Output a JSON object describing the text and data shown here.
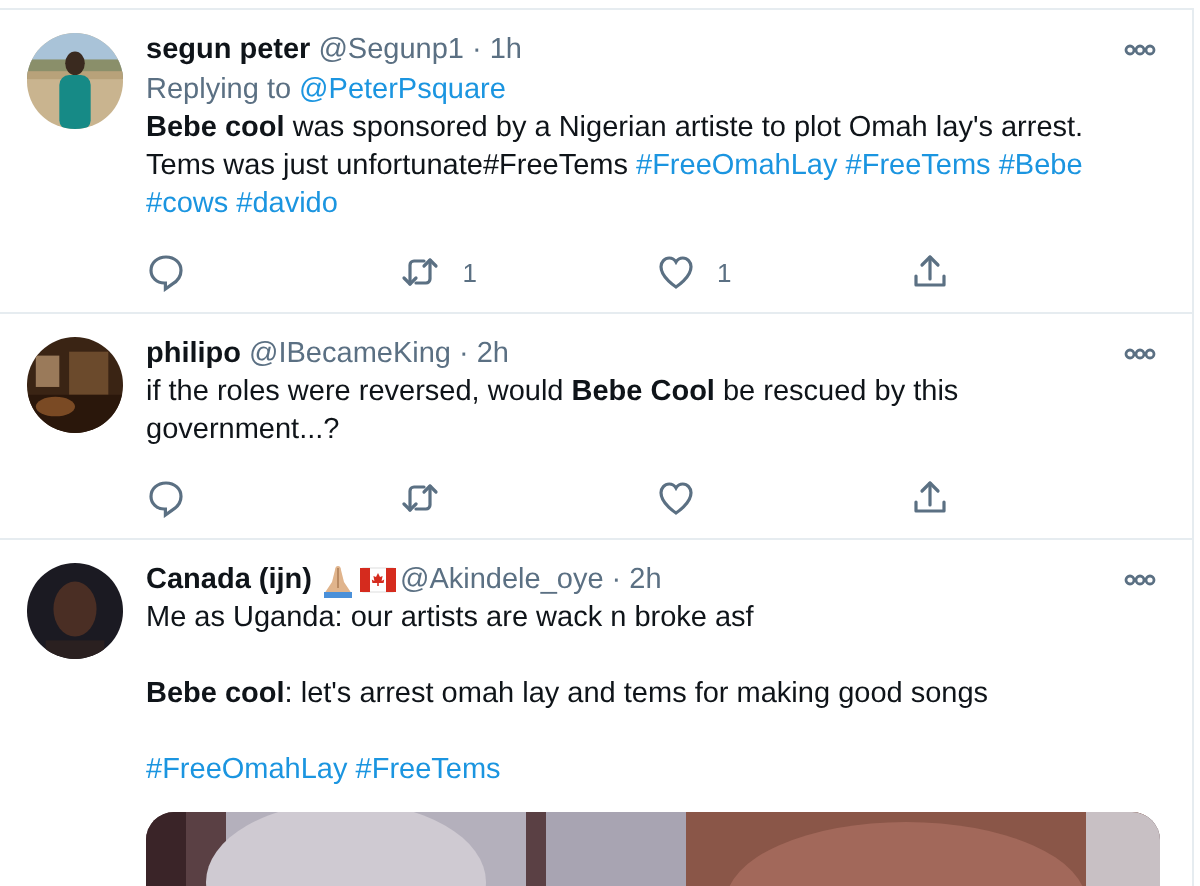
{
  "tweets": [
    {
      "name": "segun peter",
      "handle": "@Segunp1",
      "separator": "·",
      "time": "1h",
      "replying": {
        "label": "Replying to",
        "handle": "@PeterPsquare"
      },
      "paragraphs": [
        [
          {
            "kind": "text",
            "text": "**Bebe cool** was sponsored by a Nigerian artiste to plot Omah lay's arrest. Tems was just unfortunate#FreeTems "
          },
          {
            "kind": "hashtag",
            "text": "#FreeOmahLay"
          },
          {
            "kind": "hashtag",
            "text": "#FreeTems"
          },
          {
            "kind": "hashtag",
            "text": "#Bebe"
          },
          {
            "kind": "hashtag",
            "text": "#cows"
          },
          {
            "kind": "hashtag",
            "text": "#davido"
          }
        ]
      ],
      "actions": [
        {
          "kind": "reply"
        },
        {
          "kind": "retweet",
          "count": "1"
        },
        {
          "kind": "like",
          "count": "1"
        },
        {
          "kind": "share"
        }
      ]
    },
    {
      "name": "philipo",
      "handle": "@IBecameKing",
      "separator": "·",
      "time": "2h",
      "paragraphs": [
        [
          {
            "kind": "text",
            "text": "if the roles were reversed, would **Bebe Cool** be rescued by this government...?"
          }
        ]
      ],
      "actions": [
        {
          "kind": "reply"
        },
        {
          "kind": "retweet"
        },
        {
          "kind": "like"
        },
        {
          "kind": "share"
        }
      ]
    },
    {
      "name": "Canada (ijn)",
      "name_icons": [
        {
          "kind": "hands"
        },
        {
          "kind": "flag"
        }
      ],
      "handle": "@Akindele_oye",
      "separator": "·",
      "time": "2h",
      "paragraphs": [
        [
          {
            "kind": "text",
            "text": "Me as Uganda: our artists are wack n broke asf"
          }
        ],
        [
          {
            "kind": "text",
            "text": "**Bebe cool**: let's arrest omah lay and tems for making good songs"
          }
        ],
        [
          {
            "kind": "hashtag",
            "text": "#FreeOmahLay"
          },
          {
            "kind": "hashtag",
            "text": "#FreeTems"
          }
        ]
      ],
      "media": {
        "kind": "picture"
      }
    }
  ]
}
